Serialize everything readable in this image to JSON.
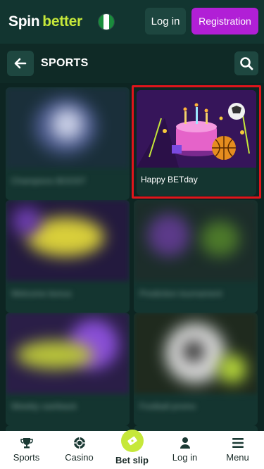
{
  "header": {
    "logo_part1": "Spin",
    "logo_part2": "better",
    "login_label": "Log in",
    "registration_label": "Registration"
  },
  "section": {
    "title": "SPORTS"
  },
  "cards": [
    {
      "caption": "Champions BOOST"
    },
    {
      "caption": "Happy BETday"
    },
    {
      "caption": "Welcome bonus"
    },
    {
      "caption": "Prediction tournament"
    },
    {
      "caption": "Weekly cashback"
    },
    {
      "caption": "Football promo"
    }
  ],
  "bottom_nav": {
    "items": [
      {
        "label": "Sports",
        "icon": "trophy-icon"
      },
      {
        "label": "Casino",
        "icon": "casino-chip-icon"
      },
      {
        "label": "Bet slip",
        "icon": "ticket-icon"
      },
      {
        "label": "Log in",
        "icon": "user-icon"
      },
      {
        "label": "Menu",
        "icon": "menu-icon"
      }
    ]
  },
  "colors": {
    "brand_green": "#c6e83a",
    "registration": "#b11fd6",
    "background": "#0f2a26",
    "highlight_frame": "#e0151b"
  }
}
